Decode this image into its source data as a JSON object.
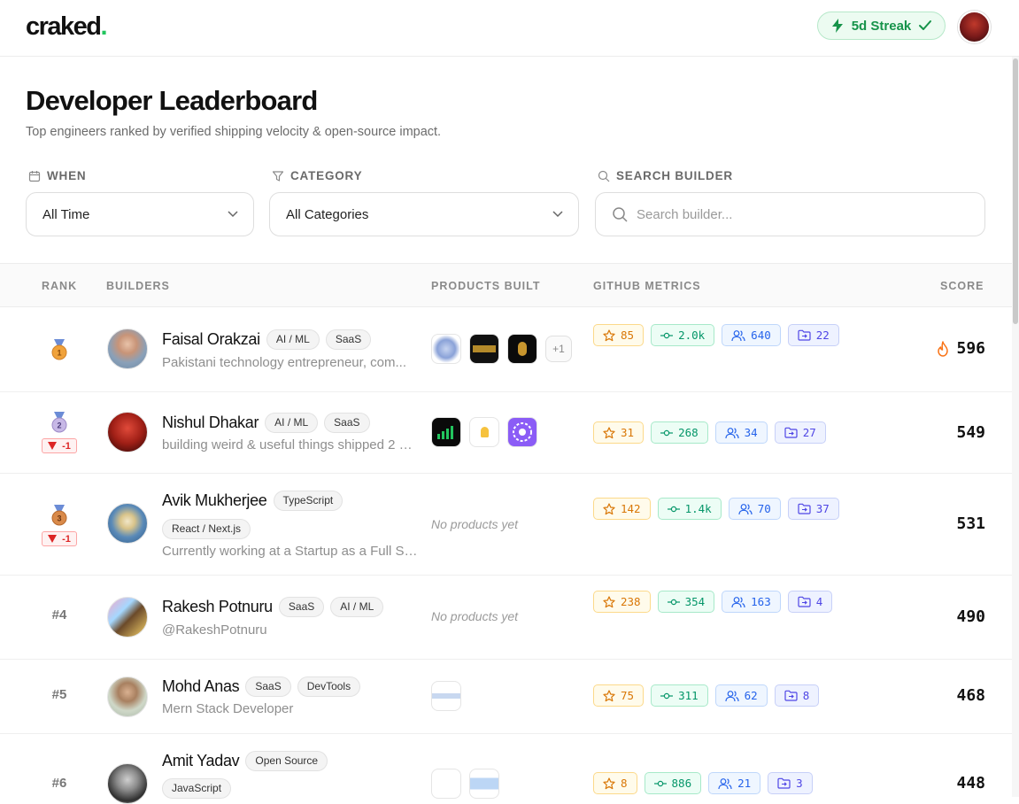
{
  "header": {
    "logo_main": "crak",
    "logo_mid": "ed",
    "logo_dot": ".",
    "streak": "5d Streak"
  },
  "page": {
    "title": "Developer Leaderboard",
    "subtitle": "Top engineers ranked by verified shipping velocity & open-source impact."
  },
  "filters": {
    "when_label": "WHEN",
    "when_value": "All Time",
    "category_label": "CATEGORY",
    "category_value": "All Categories",
    "search_label": "SEARCH BUILDER",
    "search_placeholder": "Search builder..."
  },
  "table": {
    "headers": {
      "rank": "RANK",
      "builders": "BUILDERS",
      "products": "PRODUCTS BUILT",
      "github": "GITHUB METRICS",
      "score": "SCORE"
    },
    "no_products": "No products yet",
    "rows": [
      {
        "rank": "1",
        "delta": "",
        "name": "Faisal Orakzai",
        "tags": [
          "AI / ML",
          "SaaS"
        ],
        "bio": "Pakistani technology entrepreneur, com...",
        "products_extra": "+1",
        "stars": "85",
        "commits": "2.0k",
        "followers": "640",
        "repos": "22",
        "score": "596"
      },
      {
        "rank": "2",
        "delta": "-1",
        "name": "Nishul Dhakar",
        "tags": [
          "AI / ML",
          "SaaS"
        ],
        "bio": "building weird & useful things shipped 2 S...",
        "products_extra": "",
        "stars": "31",
        "commits": "268",
        "followers": "34",
        "repos": "27",
        "score": "549"
      },
      {
        "rank": "3",
        "delta": "-1",
        "name": "Avik Mukherjee",
        "tags": [
          "TypeScript",
          "React / Next.js"
        ],
        "bio": "Currently working at a Startup as a Full St...",
        "products_extra": "",
        "stars": "142",
        "commits": "1.4k",
        "followers": "70",
        "repos": "37",
        "score": "531"
      },
      {
        "rank": "#4",
        "delta": "",
        "name": "Rakesh Potnuru",
        "tags": [
          "SaaS",
          "AI / ML"
        ],
        "bio": "@RakeshPotnuru",
        "products_extra": "",
        "stars": "238",
        "commits": "354",
        "followers": "163",
        "repos": "4",
        "score": "490"
      },
      {
        "rank": "#5",
        "delta": "",
        "name": "Mohd Anas",
        "tags": [
          "SaaS",
          "DevTools"
        ],
        "bio": "Mern Stack Developer",
        "products_extra": "",
        "stars": "75",
        "commits": "311",
        "followers": "62",
        "repos": "8",
        "score": "468"
      },
      {
        "rank": "#6",
        "delta": "",
        "name": "Amit Yadav",
        "tags": [
          "Open Source",
          "JavaScript"
        ],
        "bio": "",
        "products_extra": "",
        "stars": "8",
        "commits": "886",
        "followers": "21",
        "repos": "3",
        "score": "448"
      }
    ]
  },
  "colors": {
    "accent_green": "#22c55e",
    "star": "#d97706",
    "commit": "#059669",
    "followers": "#2563eb",
    "repos": "#4f46e5",
    "flame": "#f97316",
    "delta_red": "#dc2626"
  }
}
